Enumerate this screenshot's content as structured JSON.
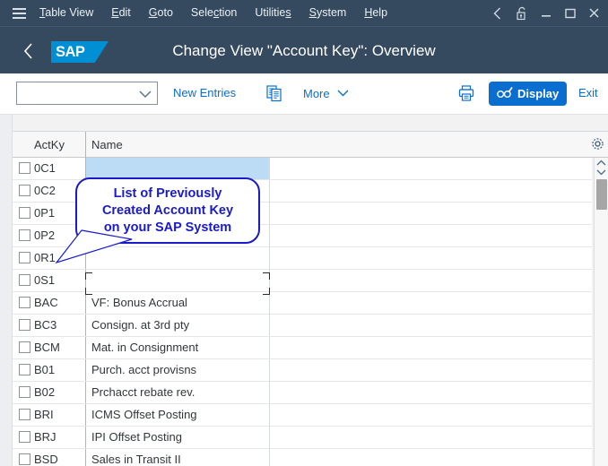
{
  "menubar": {
    "hamburger_icon": "hamburger-menu-icon",
    "items": [
      {
        "label": "Table View",
        "accel_index": 0
      },
      {
        "label": "Edit",
        "accel_index": 0
      },
      {
        "label": "Goto",
        "accel_index": 0
      },
      {
        "label": "Selection",
        "accel_index": 4
      },
      {
        "label": "Utilities",
        "accel_index": 8
      },
      {
        "label": "System",
        "accel_index": 0
      },
      {
        "label": "Help",
        "accel_index": 0
      }
    ],
    "window_controls": [
      {
        "name": "back-chevron-icon",
        "glyph": "‹"
      },
      {
        "name": "unlock-icon",
        "glyph": "🔓"
      },
      {
        "name": "minimize-icon",
        "glyph": "—"
      },
      {
        "name": "maximize-icon",
        "glyph": "□"
      },
      {
        "name": "close-icon",
        "glyph": "✕"
      }
    ]
  },
  "shell": {
    "back_icon": "back-chevron-icon",
    "logo_text": "SAP",
    "title": "Change View \"Account Key\": Overview"
  },
  "toolbar": {
    "combo_value": "",
    "combo_placeholder": "",
    "combo_icon": "chevron-down-icon",
    "new_entries_label": "New Entries",
    "copy_icon": "copy-documents-icon",
    "more_label": "More",
    "more_icon": "chevron-down-icon",
    "print_icon": "print-icon",
    "display_label": "Display",
    "display_icon": "display-glasses-icon",
    "display_color": "#0a6ed1",
    "exit_label": "Exit"
  },
  "table": {
    "settings_icon": "settings-gear-icon",
    "columns": [
      "ActKy",
      "Name"
    ],
    "selected_row_index": 0,
    "highlight_color": "#bcdcf5",
    "rows": [
      {
        "actky": "0C1",
        "name": ""
      },
      {
        "actky": "0C2",
        "name": ""
      },
      {
        "actky": "0P1",
        "name": ""
      },
      {
        "actky": "0P2",
        "name": ""
      },
      {
        "actky": "0R1",
        "name": ""
      },
      {
        "actky": "0S1",
        "name": ""
      },
      {
        "actky": "BAC",
        "name": "VF: Bonus Accrual"
      },
      {
        "actky": "BC3",
        "name": "Consign. at 3rd pty"
      },
      {
        "actky": "BCM",
        "name": "Mat. in Consignment"
      },
      {
        "actky": "B01",
        "name": "Purch. acct provisns"
      },
      {
        "actky": "B02",
        "name": "Prchacct rebate rev."
      },
      {
        "actky": "BRI",
        "name": "ICMS Offset Posting"
      },
      {
        "actky": "BRJ",
        "name": "IPI Offset Posting"
      },
      {
        "actky": "BSD",
        "name": "Sales in Transit II"
      }
    ]
  },
  "scrollbar": {
    "up_icon": "chevron-up-icon",
    "down_icon": "chevron-down-icon"
  },
  "annotation": {
    "callout_text": "List of Previously\nCreated Account Key\non your SAP System",
    "border_color": "#1a1ac8"
  }
}
